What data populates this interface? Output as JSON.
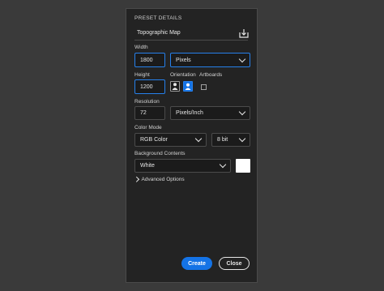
{
  "preset": {
    "section_title": "PRESET DETAILS",
    "name_value": "Topographic Map"
  },
  "width": {
    "label": "Width",
    "value": "1800",
    "unit": "Pixels"
  },
  "height": {
    "label": "Height",
    "value": "1200"
  },
  "orientation": {
    "label": "Orientation",
    "selected": "landscape"
  },
  "artboards": {
    "label": "Artboards",
    "checked": false
  },
  "resolution": {
    "label": "Resolution",
    "value": "72",
    "unit": "Pixels/Inch"
  },
  "color_mode": {
    "label": "Color Mode",
    "mode": "RGB Color",
    "depth": "8 bit"
  },
  "background": {
    "label": "Background Contents",
    "value": "White",
    "swatch_color": "#ffffff"
  },
  "advanced": {
    "label": "Advanced Options"
  },
  "buttons": {
    "create": "Create",
    "close": "Close"
  },
  "colors": {
    "accent": "#2680eb",
    "create_button": "#1473e6",
    "panel": "#232323",
    "page_bg": "#3a3a3a"
  }
}
